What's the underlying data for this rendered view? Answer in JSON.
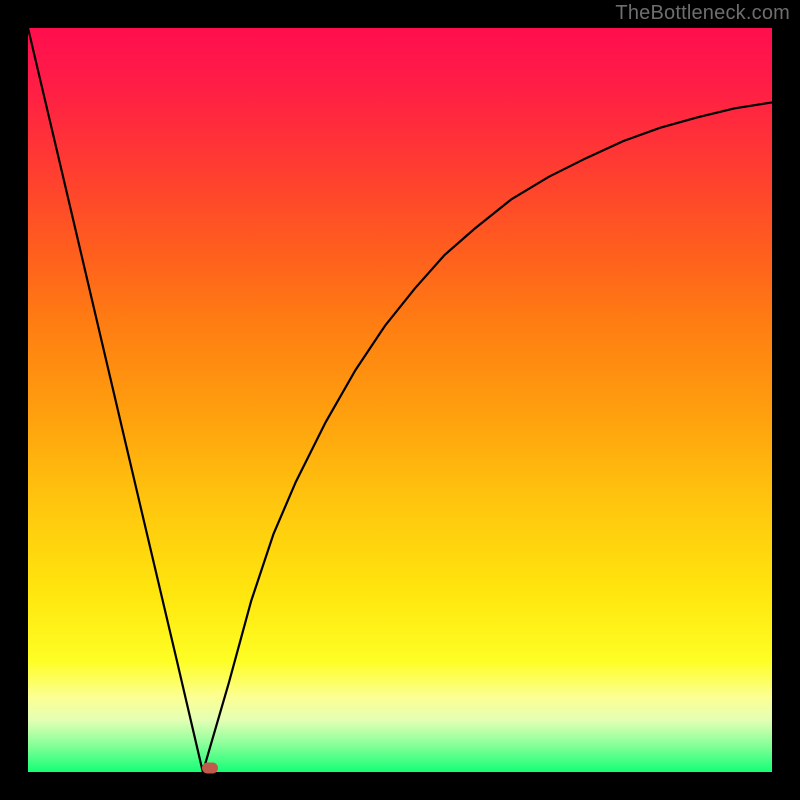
{
  "attribution": "TheBottleneck.com",
  "colors": {
    "frame": "#000000",
    "curve": "#000000",
    "marker": "#c05a4a",
    "gradient_stops": [
      "#ff0e4e",
      "#ff1e46",
      "#ff3a32",
      "#ff5e1e",
      "#ff7e12",
      "#ffa00e",
      "#ffc60e",
      "#ffe60e",
      "#fefe24",
      "#fcff94",
      "#e4ffb4",
      "#92ff9c",
      "#14ff76"
    ]
  },
  "chart_data": {
    "type": "line",
    "title": "",
    "xlabel": "",
    "ylabel": "",
    "xlim": [
      0,
      1
    ],
    "ylim": [
      0,
      1
    ],
    "x": [
      0.0,
      0.05,
      0.1,
      0.15,
      0.2,
      0.235,
      0.27,
      0.3,
      0.33,
      0.36,
      0.4,
      0.44,
      0.48,
      0.52,
      0.56,
      0.6,
      0.65,
      0.7,
      0.75,
      0.8,
      0.85,
      0.9,
      0.95,
      1.0
    ],
    "values": [
      1.0,
      0.788,
      0.575,
      0.362,
      0.15,
      0.0,
      0.12,
      0.23,
      0.32,
      0.39,
      0.47,
      0.54,
      0.6,
      0.65,
      0.695,
      0.73,
      0.77,
      0.8,
      0.825,
      0.848,
      0.866,
      0.88,
      0.892,
      0.9
    ],
    "marker": {
      "x": 0.245,
      "y": 0.005
    }
  }
}
